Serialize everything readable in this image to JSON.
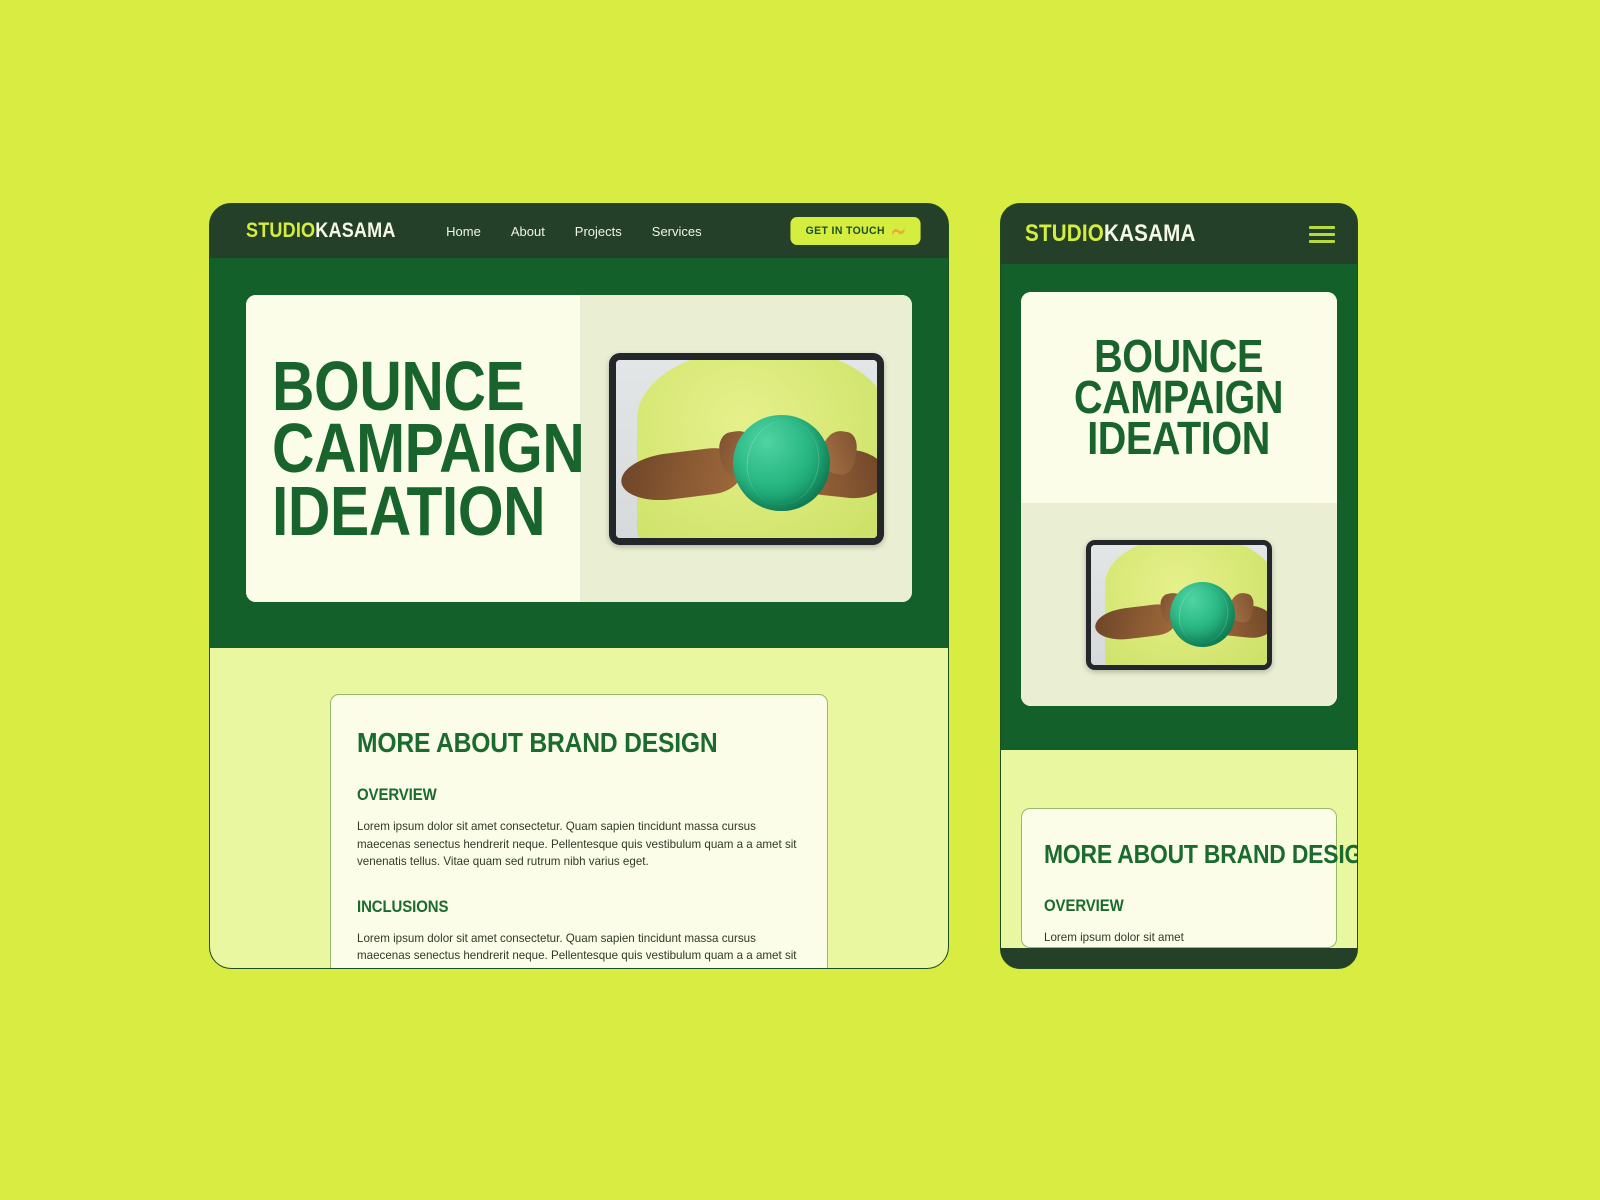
{
  "theme": {
    "page_bg": "#d8ec41",
    "header_green": "#254029",
    "hero_green": "#14602b",
    "lower_lime": "#e8f7a0",
    "cream": "#fbfde8",
    "cream_alt": "#eaefd4",
    "accent_lime": "#d4ed3e",
    "title_green": "#19632c"
  },
  "brand": {
    "part_one": "STUDIO",
    "part_two": "KASAMA"
  },
  "desktop": {
    "nav": [
      {
        "label": "Home"
      },
      {
        "label": "About"
      },
      {
        "label": "Projects"
      },
      {
        "label": "Services"
      }
    ],
    "cta_label": "GET IN TOUCH",
    "cta_icon": "wave-hand-icon",
    "hero_title": "BOUNCE\nCAMPAIGN\nIDEATION",
    "hero_image_alt": "person-holding-teal-ball-on-tablet",
    "card": {
      "title": "MORE ABOUT BRAND DESIGN",
      "blocks": [
        {
          "heading": "OVERVIEW",
          "text": "Lorem ipsum dolor sit amet consectetur. Quam sapien tincidunt massa cursus maecenas senectus hendrerit neque. Pellentesque quis vestibulum quam a a amet sit venenatis tellus. Vitae quam sed rutrum nibh varius eget."
        },
        {
          "heading": "INCLUSIONS",
          "text": "Lorem ipsum dolor sit amet consectetur. Quam sapien tincidunt massa cursus maecenas senectus hendrerit neque. Pellentesque quis vestibulum quam a a amet sit venenatis tellus. Vitae quam sed rutrum nibh varius eget."
        }
      ]
    }
  },
  "mobile": {
    "menu_icon": "hamburger-menu-icon",
    "hero_title": "BOUNCE\nCAMPAIGN\nIDEATION",
    "hero_image_alt": "person-holding-teal-ball-on-tablet",
    "card": {
      "title": "MORE ABOUT BRAND DESIGN",
      "blocks": [
        {
          "heading": "OVERVIEW",
          "text": "Lorem ipsum dolor sit amet"
        }
      ]
    }
  }
}
